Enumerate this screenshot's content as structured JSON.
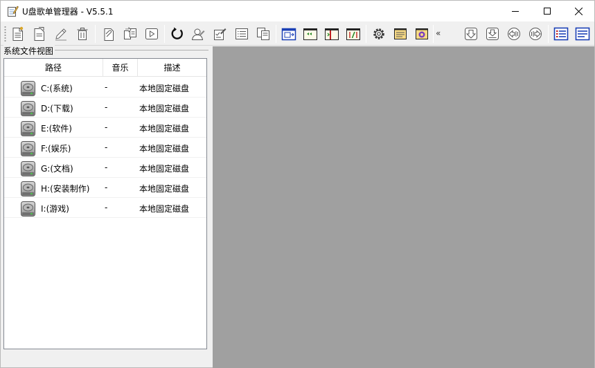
{
  "window": {
    "title": "U盘歌单管理器  - V5.5.1",
    "controls": {
      "minimize": "minimize",
      "maximize": "maximize",
      "close": "close"
    }
  },
  "toolbar": {
    "overflow_glyph": "«",
    "buttons": [
      "new-list-icon",
      "open-list-icon",
      "edit-icon",
      "delete-icon",
      "attach-icon",
      "copy-move-icon",
      "play-icon",
      "refresh-icon",
      "user-icon",
      "checklist-edit-icon",
      "list-icon",
      "duplicate-icon",
      "window-layout-icon",
      "rewind-window-icon",
      "split-window-icon",
      "tag-window-icon",
      "settings-icon",
      "document-icon",
      "about-icon",
      "download-icon",
      "import-icon",
      "left-right-icon",
      "right-left-icon",
      "view-details-icon",
      "view-list-icon"
    ]
  },
  "panel": {
    "group_label": "系统文件视图",
    "columns": {
      "path": "路径",
      "music": "音乐",
      "desc": "描述"
    },
    "rows": [
      {
        "path": "C:(系统)",
        "music": "-",
        "desc": "本地固定磁盘"
      },
      {
        "path": "D:(下载)",
        "music": "-",
        "desc": "本地固定磁盘"
      },
      {
        "path": "E:(软件)",
        "music": "-",
        "desc": "本地固定磁盘"
      },
      {
        "path": "F:(娱乐)",
        "music": "-",
        "desc": "本地固定磁盘"
      },
      {
        "path": "G:(文档)",
        "music": "-",
        "desc": "本地固定磁盘"
      },
      {
        "path": "H:(安装制作)",
        "music": "-",
        "desc": "本地固定磁盘"
      },
      {
        "path": "I:(游戏)",
        "music": "-",
        "desc": "本地固定磁盘"
      }
    ]
  },
  "colors": {
    "workspace": "#a0a0a0",
    "chrome": "#f0f0f0",
    "accent_blue": "#1a3fb5"
  }
}
